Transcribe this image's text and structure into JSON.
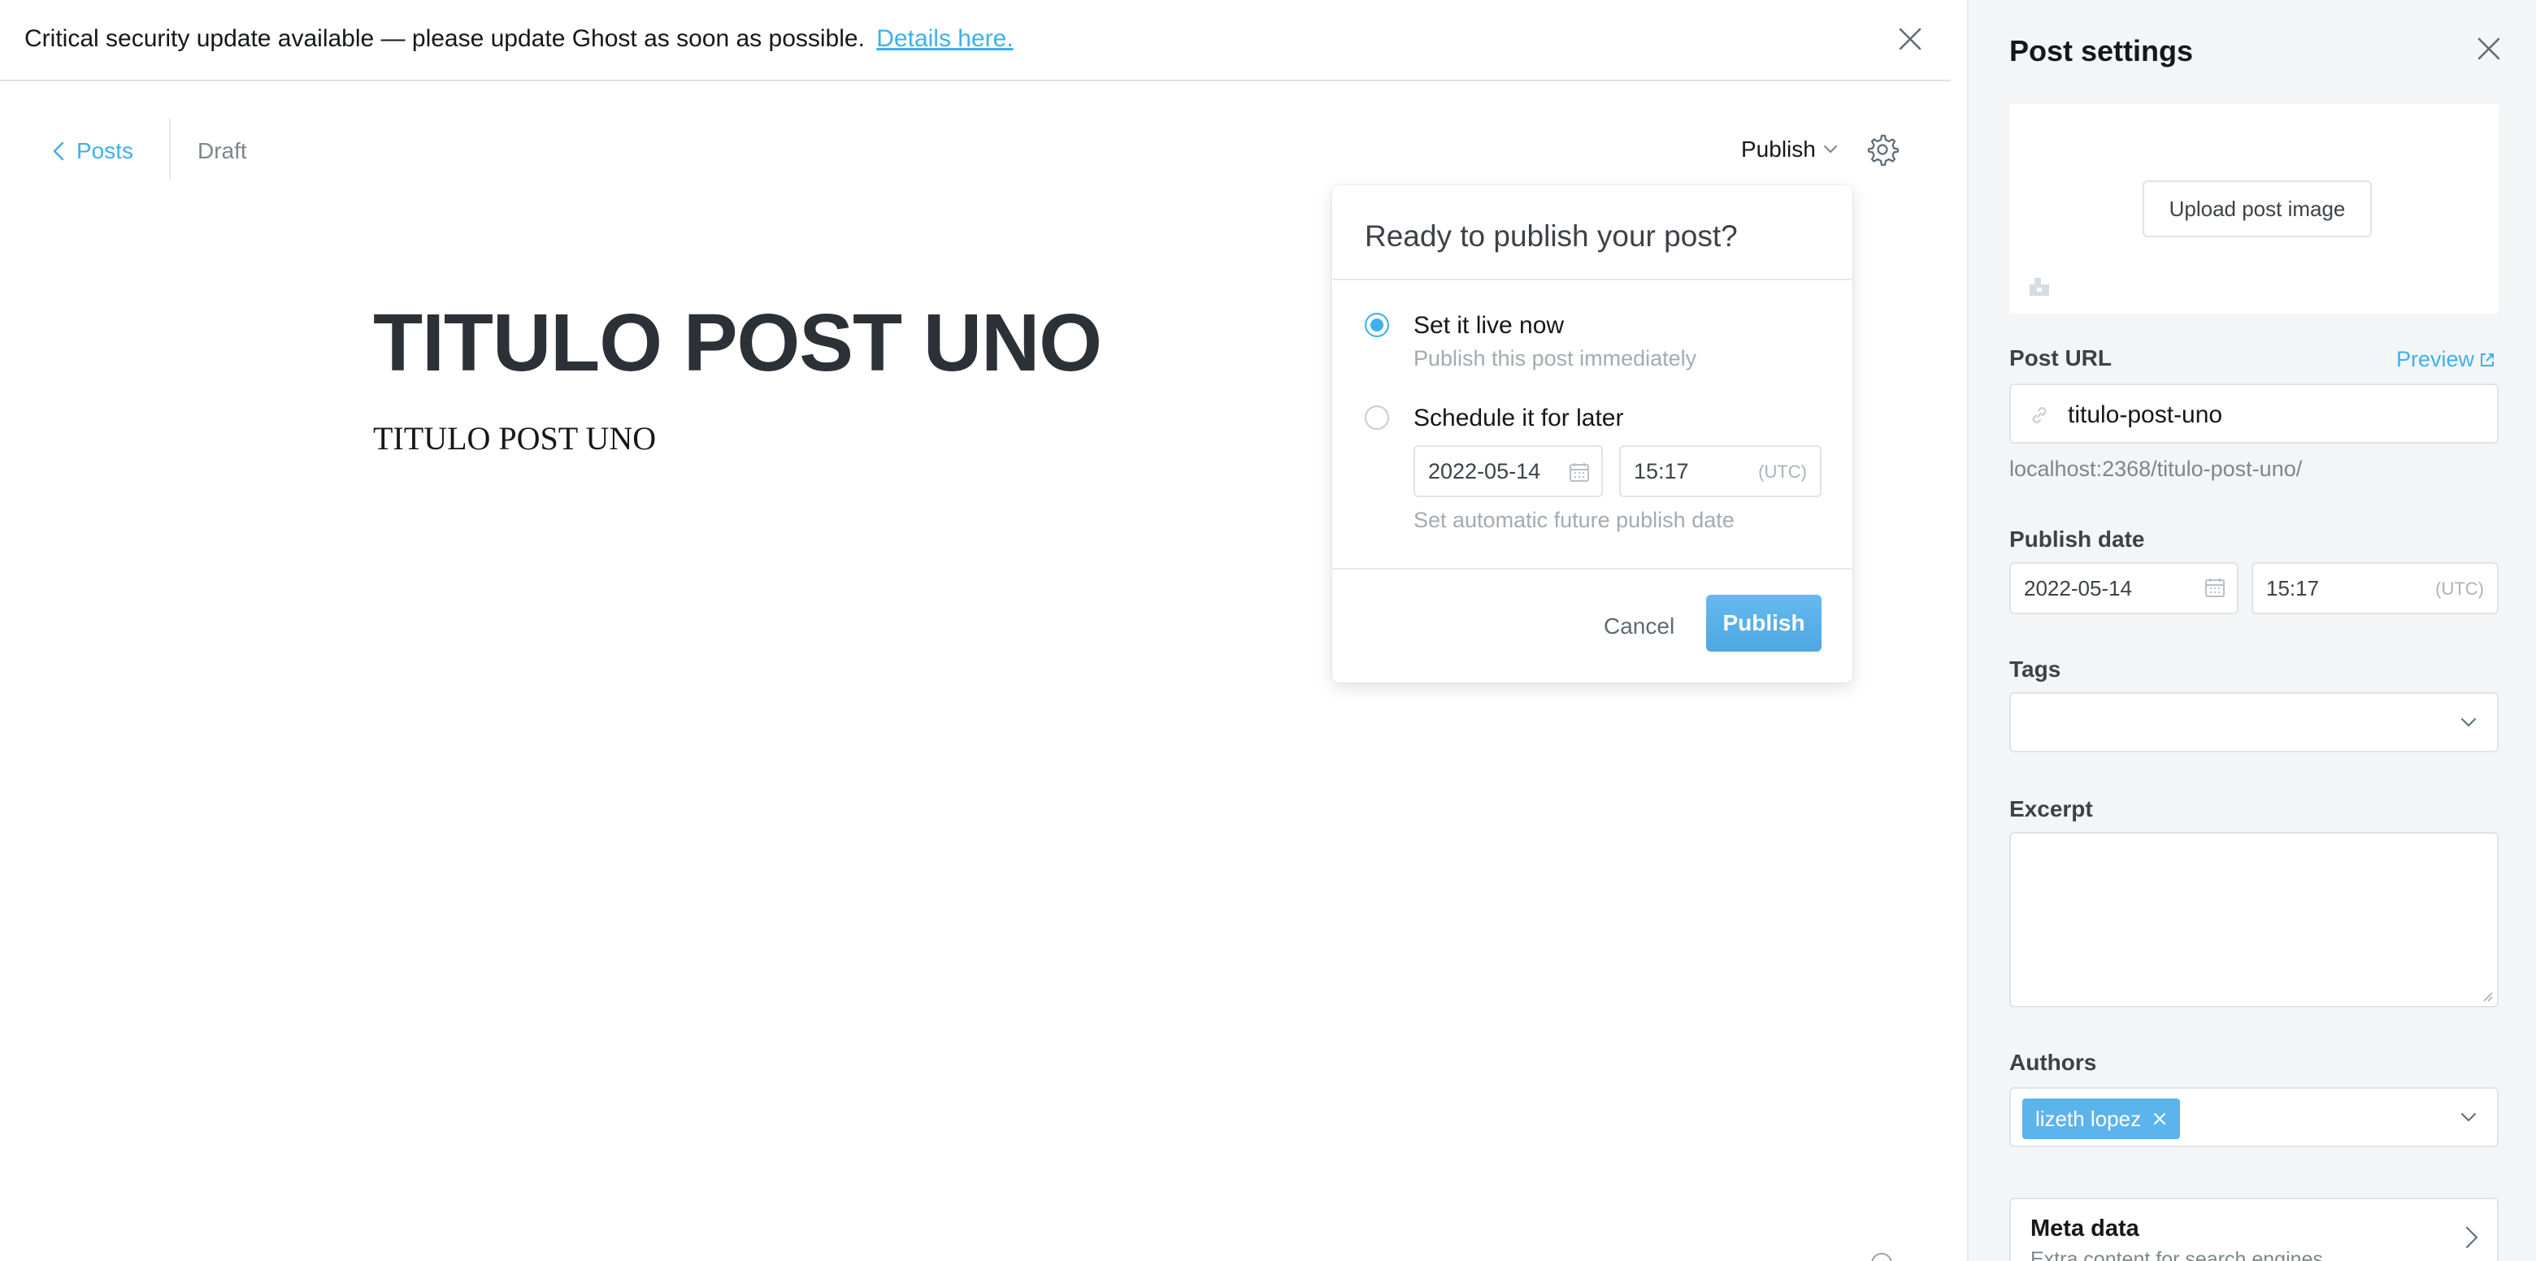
{
  "banner": {
    "message": "Critical security update available — please update Ghost as soon as possible.",
    "link": "Details here."
  },
  "header": {
    "back_label": "Posts",
    "status": "Draft",
    "publish_label": "Publish"
  },
  "post": {
    "title": "TITULO POST UNO",
    "body": "TITULO POST UNO"
  },
  "publish_menu": {
    "title": "Ready to publish your post?",
    "option_now": {
      "label": "Set it live now",
      "description": "Publish this post immediately",
      "selected": true
    },
    "option_schedule": {
      "label": "Schedule it for later",
      "description": "Set automatic future publish date",
      "selected": false
    },
    "date": "2022-05-14",
    "time": "15:17",
    "timezone": "(UTC)",
    "cancel_label": "Cancel",
    "publish_label": "Publish"
  },
  "settings": {
    "title": "Post settings",
    "upload_label": "Upload post image",
    "post_url_label": "Post URL",
    "preview_label": "Preview",
    "slug": "titulo-post-uno",
    "url_hint": "localhost:2368/titulo-post-uno/",
    "publish_date_label": "Publish date",
    "date": "2022-05-14",
    "time": "15:17",
    "timezone": "(UTC)",
    "tags_label": "Tags",
    "excerpt_label": "Excerpt",
    "authors_label": "Authors",
    "author": "lizeth lopez",
    "meta_title": "Meta data",
    "meta_sub": "Extra content for search engines"
  },
  "colors": {
    "accent": "#3eb0ef",
    "publish_button": "#5bb4eb",
    "panel_bg": "#f4f5f6"
  },
  "icons": {
    "banner_close": "close-icon",
    "back": "chevron-left-icon",
    "settings": "gear-icon",
    "calendar": "calendar-icon",
    "link": "link-icon",
    "external": "external-link-icon"
  }
}
